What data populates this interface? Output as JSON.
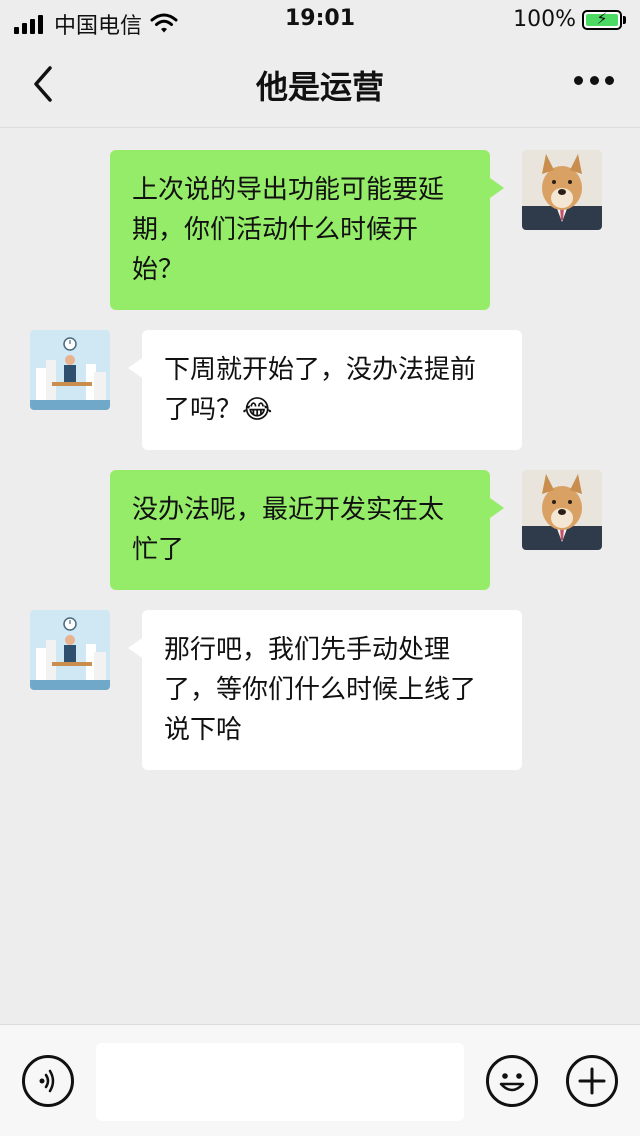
{
  "status_bar": {
    "carrier": "中国电信",
    "time": "19:01",
    "battery": "100%",
    "battery_level": 1.0
  },
  "nav": {
    "title": "他是运营",
    "back_icon": "chevron-left-icon",
    "more_icon": "more-dots-icon"
  },
  "messages": [
    {
      "direction": "out",
      "text": "上次说的导出功能可能要延期，你们活动什么时候开始？"
    },
    {
      "direction": "in",
      "text": "下周就开始了，没办法提前了吗？😂"
    },
    {
      "direction": "out",
      "text": "没办法呢，最近开发实在太忙了"
    },
    {
      "direction": "in",
      "text": "那行吧，我们先手动处理了，等你们什么时候上线了说下哈"
    }
  ],
  "input_bar": {
    "voice_icon": "voice-icon",
    "emoji_icon": "emoji-icon",
    "plus_icon": "plus-icon",
    "input_value": ""
  },
  "colors": {
    "background": "#ededed",
    "outgoing_bubble": "#95ec69",
    "incoming_bubble": "#ffffff",
    "battery_fill": "#4cd964"
  }
}
